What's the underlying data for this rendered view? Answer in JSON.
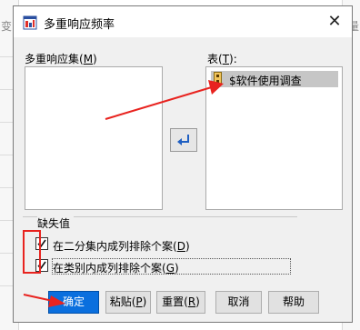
{
  "background": {
    "left_hint": "变",
    "right_hint": "量"
  },
  "window": {
    "title": "多重响应频率",
    "close_glyph": "✕"
  },
  "mr_sets": {
    "label": "多重响应集(",
    "hotkey": "M",
    "label_end": ")"
  },
  "table": {
    "label": "表(",
    "hotkey": "T",
    "label_end": "):",
    "items": [
      {
        "label": "$软件使用调查",
        "icon": "multi-response-set-icon"
      }
    ]
  },
  "move_button": {
    "icon": "arrow-left-icon"
  },
  "missing_values": {
    "title": "缺失值",
    "options": [
      {
        "label": "在二分集内成列排除个案(",
        "hotkey": "D",
        "label_end": ")",
        "checked": true
      },
      {
        "label": "在类别内成列排除个案(",
        "hotkey": "G",
        "label_end": ")",
        "checked": true
      }
    ]
  },
  "buttons": {
    "ok": {
      "label": "确定"
    },
    "paste": {
      "label": "粘贴(",
      "hotkey": "P",
      "label_end": ")"
    },
    "reset": {
      "label": "重置(",
      "hotkey": "R",
      "label_end": ")"
    },
    "cancel": {
      "label": "取消"
    },
    "help": {
      "label": "帮助"
    }
  },
  "annotation_color": "#e8231f",
  "primary_button_color": "#0a6fde"
}
